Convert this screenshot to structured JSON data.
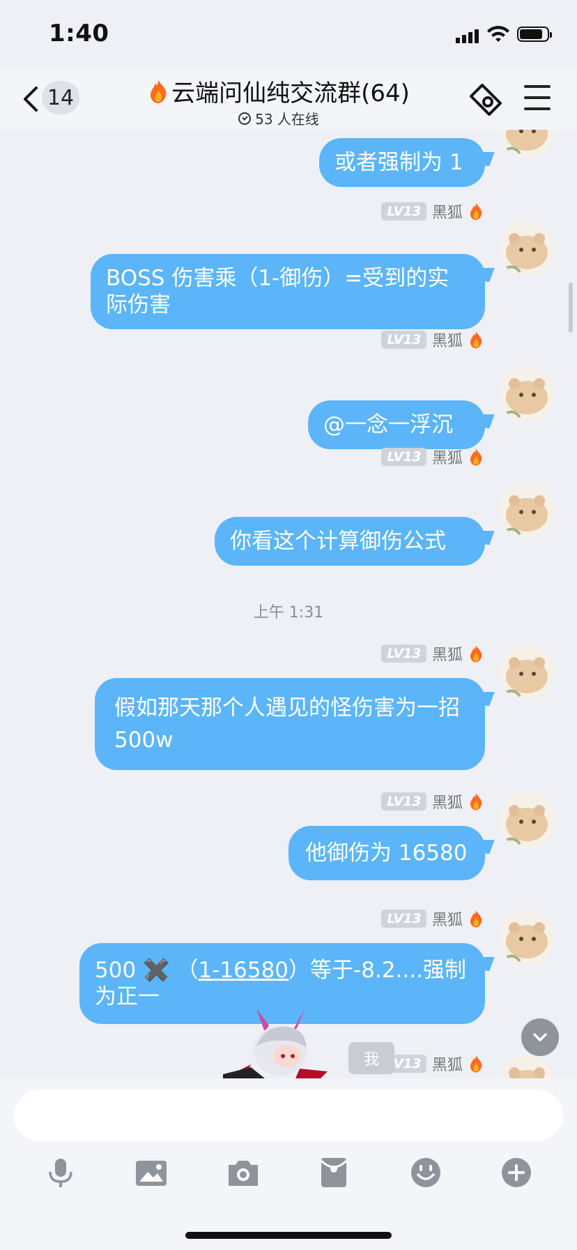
{
  "status_bar": {
    "time": "1:40"
  },
  "header": {
    "back_count": "14",
    "title": "云端问仙纯交流群(64)",
    "online": "53 人在线"
  },
  "messages": [
    {
      "id": "m1",
      "text": "或者强制为 1"
    },
    {
      "id": "m2",
      "lv": "LV13",
      "name": "黑狐",
      "text": "BOSS 伤害乘（1-御伤）=受到的实际伤害"
    },
    {
      "id": "m3",
      "lv": "LV13",
      "name": "黑狐",
      "text": "@一念一浮沉"
    },
    {
      "id": "m4",
      "lv": "LV13",
      "name": "黑狐",
      "text": "你看这个计算御伤公式"
    },
    {
      "id": "m5",
      "lv": "LV13",
      "name": "黑狐",
      "text": "假如那天那个人遇见的怪伤害为一招 500w"
    },
    {
      "id": "m6",
      "lv": "LV13",
      "name": "黑狐",
      "text": "他御伤为 16580"
    },
    {
      "id": "m7",
      "lv": "LV13",
      "name": "黑狐",
      "text_a": "500 ✖️ （",
      "text_link": "1-16580",
      "text_b": "）等于-8.2....强制为正一"
    },
    {
      "id": "m8",
      "lv": "LV13",
      "name": "黑狐"
    }
  ],
  "timestamp": "上午 1:31",
  "me_tag": "我",
  "toolbar": {
    "items": [
      "microphone-icon",
      "image-icon",
      "camera-icon",
      "red-packet-icon",
      "emoji-icon",
      "plus-icon"
    ]
  },
  "colors": {
    "bubble": "#5bb5f8",
    "background": "#eef0f6"
  }
}
